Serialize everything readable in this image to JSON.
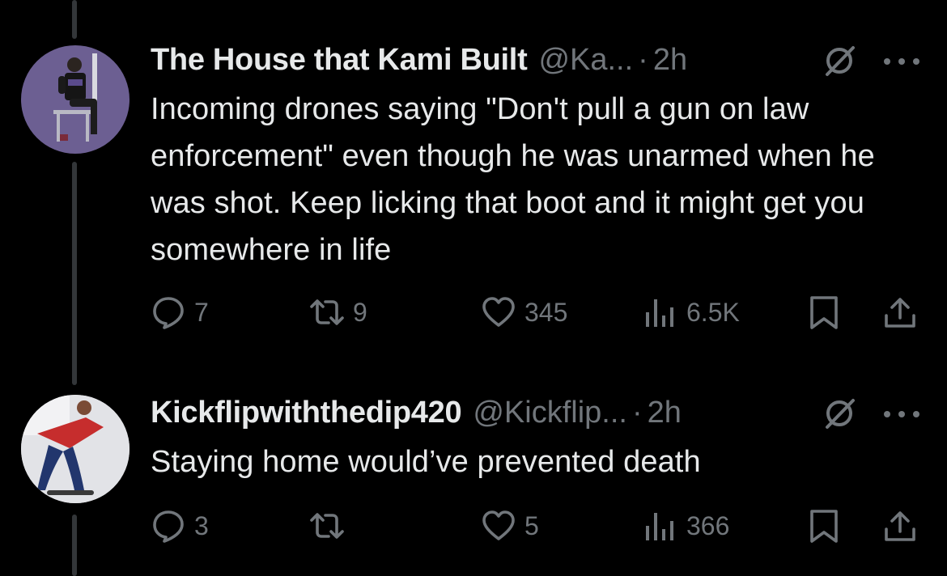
{
  "posts": [
    {
      "display_name": "The House that Kami Built",
      "handle": "@Ka...",
      "separator": "·",
      "time": "2h",
      "text": "Incoming drones saying \"Don't pull a gun on law enforcement\" even though he was unarmed when he was shot. Keep licking that boot and it might get you somewhere in life",
      "replies": "7",
      "reposts": "9",
      "likes": "345",
      "views": "6.5K"
    },
    {
      "display_name": "Kickflipwiththedip420",
      "handle": "@Kickflip...",
      "separator": "·",
      "time": "2h",
      "text": "Staying home would’ve prevented death",
      "replies": "3",
      "reposts": "",
      "likes": "5",
      "views": "366"
    }
  ],
  "icons": {
    "reply": "reply-icon",
    "repost": "repost-icon",
    "like": "like-icon",
    "views": "views-icon",
    "bookmark": "bookmark-icon",
    "share": "share-icon",
    "grok": "grok-icon",
    "more": "more-icon"
  },
  "colors": {
    "background": "#000000",
    "primary_text": "#e7e9ea",
    "secondary_text": "#71767b",
    "thread_line": "#333639"
  }
}
